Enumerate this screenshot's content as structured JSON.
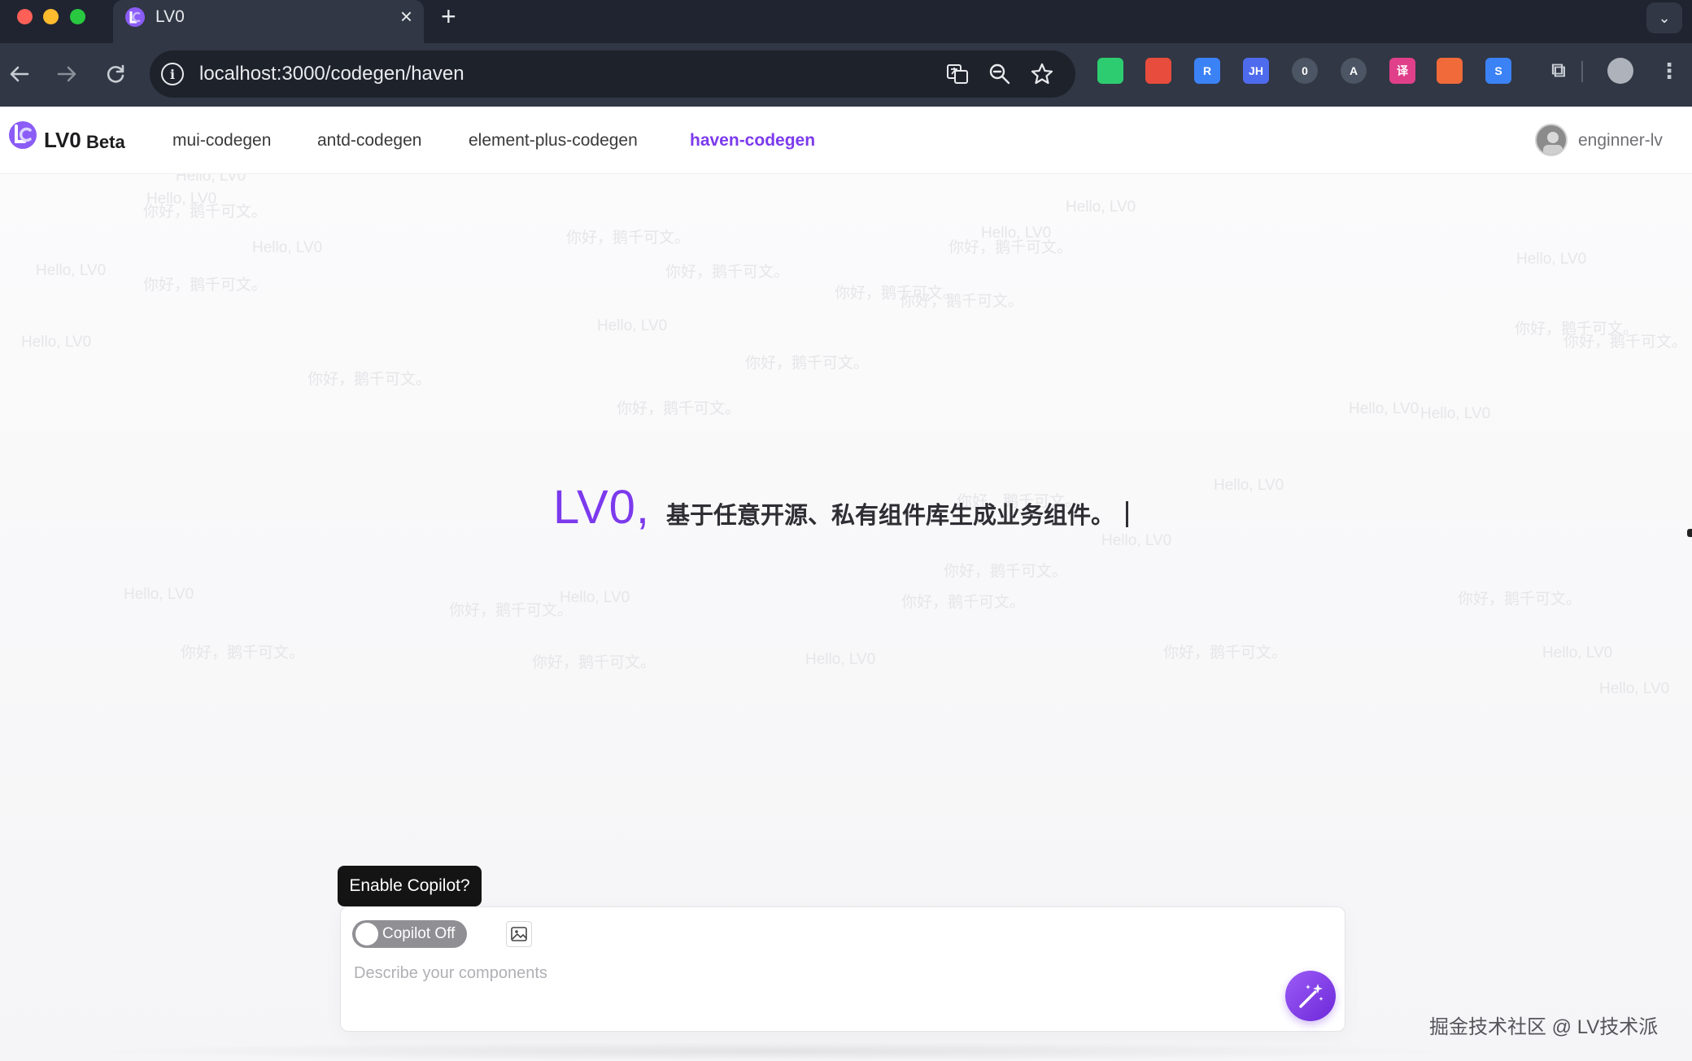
{
  "browser": {
    "tab_title": "LV0",
    "close_glyph": "×",
    "newtab_glyph": "+",
    "dropdown_glyph": "⌄",
    "url": "localhost:3000/codegen/haven",
    "info_glyph": "i",
    "extensions": [
      {
        "name": "radar-extension-icon",
        "color": "#2ecc71",
        "glyph": ""
      },
      {
        "name": "red-fox-extension-icon",
        "color": "#e74c3c",
        "glyph": ""
      },
      {
        "name": "blue-r-extension-icon",
        "color": "#3b82f6",
        "glyph": "R"
      },
      {
        "name": "jh-extension-icon",
        "color": "#4f6bed",
        "glyph": "JH"
      },
      {
        "name": "sync-extension-icon",
        "color": "#4b5563",
        "glyph": "0"
      },
      {
        "name": "circle-a-extension-icon",
        "color": "#4b5563",
        "glyph": "A"
      },
      {
        "name": "translate-extension-icon",
        "color": "#e0408a",
        "glyph": "译"
      },
      {
        "name": "orange-extension-icon",
        "color": "#f06a3a",
        "glyph": ""
      },
      {
        "name": "s-shield-extension-icon",
        "color": "#3b82f6",
        "glyph": "S"
      }
    ]
  },
  "header": {
    "logo_text": "LV0",
    "logo_badge": "Beta",
    "nav": [
      {
        "label": "mui-codegen",
        "active": false
      },
      {
        "label": "antd-codegen",
        "active": false
      },
      {
        "label": "element-plus-codegen",
        "active": false
      },
      {
        "label": "haven-codegen",
        "active": true
      }
    ],
    "user_name": "enginner-lv"
  },
  "background_texts": [
    "Hello, LV0",
    "你好，鹅千可文。"
  ],
  "hero": {
    "brand": "LV0,",
    "tagline": "基于任意开源、私有组件库生成业务组件。"
  },
  "composer": {
    "tooltip": "Enable Copilot?",
    "copilot_label": "Copilot Off",
    "placeholder": "Describe your components"
  },
  "watermark": "掘金技术社区 @ LV技术派",
  "colors": {
    "accent": "#7c3aed",
    "chrome_dark": "#1f2430",
    "chrome_toolbar": "#313744"
  }
}
